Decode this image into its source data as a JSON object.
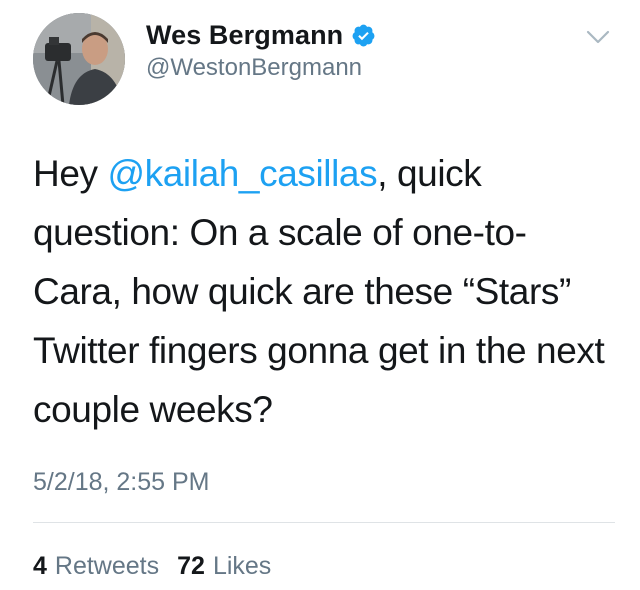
{
  "author": {
    "display_name": "Wes Bergmann",
    "handle": "@WestonBergmann",
    "verified": true,
    "avatar_icon": "profile-photo"
  },
  "tweet": {
    "text_before_mention": "Hey ",
    "mention": "@kailah_casillas",
    "text_after_mention": ", quick question: On a scale of one-to-Cara, how quick are these “Stars” Twitter fingers gonna get in the next couple weeks?",
    "timestamp": "5/2/18, 2:55 PM"
  },
  "stats": {
    "retweets_count": "4",
    "retweets_label": "Retweets",
    "likes_count": "72",
    "likes_label": "Likes"
  },
  "colors": {
    "mention": "#1da1f2",
    "secondary_text": "#657786",
    "primary_text": "#14171a",
    "verified_badge": "#1da1f2"
  },
  "icons": {
    "menu": "chevron-down-icon",
    "verified": "verified-badge-icon"
  }
}
